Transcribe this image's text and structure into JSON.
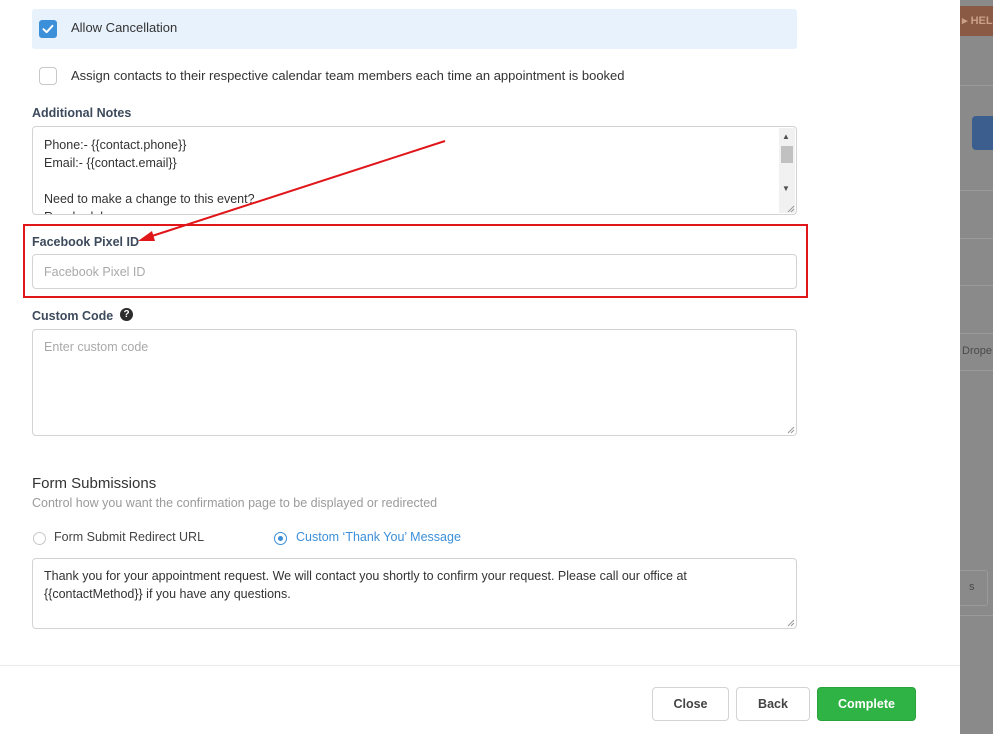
{
  "backdrop": {
    "help_text": "HEL",
    "dropdown_fragment": "Drope",
    "small_fragment": "s"
  },
  "options": {
    "allow_cancellation": {
      "label": "Allow Cancellation",
      "checked": true
    },
    "assign_contacts": {
      "label": "Assign contacts to their respective calendar team members each time an appointment is booked",
      "checked": false
    }
  },
  "additional_notes": {
    "label": "Additional Notes",
    "value": "Phone:- {{contact.phone}}\nEmail:- {{contact.email}}\n\nNeed to make a change to this event?\nReschedule:"
  },
  "facebook_pixel": {
    "label": "Facebook Pixel ID",
    "placeholder": "Facebook Pixel ID",
    "value": ""
  },
  "custom_code": {
    "label": "Custom Code",
    "placeholder": "Enter custom code",
    "help_icon": "question-circle-icon"
  },
  "form_submissions": {
    "title": "Form Submissions",
    "subtitle": "Control how you want the confirmation page to be displayed or redirected",
    "options": [
      {
        "label": "Form Submit Redirect URL",
        "selected": false
      },
      {
        "label": "Custom ‘Thank You’ Message",
        "selected": true
      }
    ],
    "message": "Thank you for your appointment request. We will contact you shortly to confirm your request. Please call our office at {{contactMethod}} if you have any questions."
  },
  "footer": {
    "close_label": "Close",
    "back_label": "Back",
    "complete_label": "Complete"
  },
  "colors": {
    "accent": "#3c8fd9",
    "complete": "#2fb344",
    "highlight": "#e0161b",
    "checked_row_bg": "#e8f2fc"
  }
}
